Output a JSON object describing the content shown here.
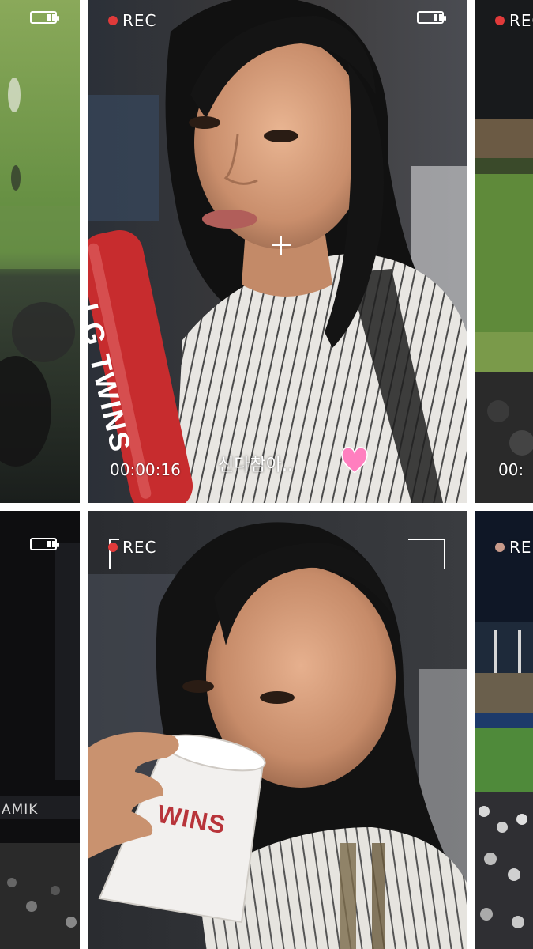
{
  "frames": {
    "top_left": {
      "battery": "battery-icon"
    },
    "top_center": {
      "rec": "REC",
      "timecode": "00:00:16",
      "caption": "신다참아..",
      "bat_text": "LG TWINS"
    },
    "top_right": {
      "rec": "REC",
      "timecode": "00:"
    },
    "bottom_left": {
      "signage": "AMIK"
    },
    "bottom_center": {
      "rec": "REC",
      "cup_text": "WINS"
    },
    "bottom_right": {
      "rec": "RE"
    }
  },
  "colors": {
    "rec_dot": "#e03a3a",
    "heart": "#ff7fbf"
  }
}
